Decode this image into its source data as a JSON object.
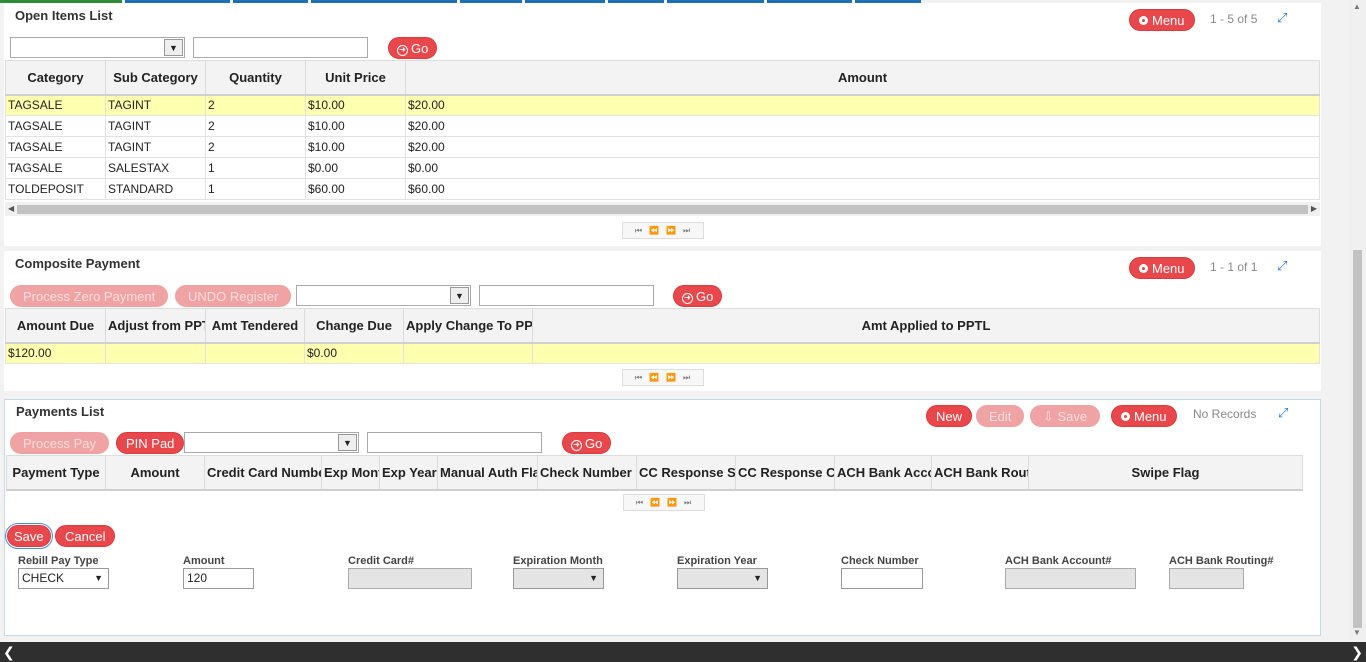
{
  "open_items": {
    "title": "Open Items List",
    "menu_label": "Menu",
    "count": "1 - 5 of 5",
    "go_label": "Go",
    "columns": [
      "Category",
      "Sub Category",
      "Quantity",
      "Unit Price",
      "Amount"
    ],
    "rows": [
      [
        "TAGSALE",
        "TAGINT",
        "2",
        "$10.00",
        "$20.00"
      ],
      [
        "TAGSALE",
        "TAGINT",
        "2",
        "$10.00",
        "$20.00"
      ],
      [
        "TAGSALE",
        "TAGINT",
        "2",
        "$10.00",
        "$20.00"
      ],
      [
        "TAGSALE",
        "SALESTAX",
        "1",
        "$0.00",
        "$0.00"
      ],
      [
        "TOLDEPOSIT",
        "STANDARD",
        "1",
        "$60.00",
        "$60.00"
      ]
    ]
  },
  "composite": {
    "title": "Composite Payment",
    "menu_label": "Menu",
    "count": "1 - 1 of 1",
    "process_zero_label": "Process Zero Payment",
    "undo_label": "UNDO Register",
    "go_label": "Go",
    "columns": [
      "Amount Due",
      "Adjust from PPTL",
      "Amt Tendered",
      "Change Due",
      "Apply Change To PPTL",
      "Amt Applied to PPTL"
    ],
    "rows": [
      [
        "$120.00",
        "",
        "",
        "$0.00",
        "",
        ""
      ]
    ]
  },
  "payments": {
    "title": "Payments List",
    "new_label": "New",
    "edit_label": "Edit",
    "save_label": "Save",
    "menu_label": "Menu",
    "count": "No Records",
    "process_pay_label": "Process Pay",
    "pin_pad_label": "PIN Pad",
    "go_label": "Go",
    "columns": [
      "Payment Type",
      "Amount",
      "Credit Card Number",
      "Exp Month",
      "Exp Year",
      "Manual Auth Flag",
      "Check Number",
      "CC Response Status",
      "CC Response Code",
      "ACH Bank Account",
      "ACH Bank Routing",
      "Swipe Flag"
    ]
  },
  "form": {
    "save_label": "Save",
    "cancel_label": "Cancel",
    "rebill_label": "Rebill Pay Type",
    "rebill_value": "CHECK",
    "amount_label": "Amount",
    "amount_value": "120",
    "cc_label": "Credit Card#",
    "exp_month_label": "Expiration Month",
    "exp_year_label": "Expiration Year",
    "check_label": "Check Number",
    "ach_account_label": "ACH Bank Account#",
    "ach_routing_label": "ACH Bank Routing#"
  }
}
